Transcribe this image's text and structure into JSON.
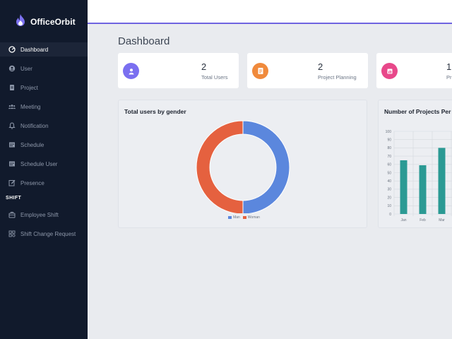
{
  "app": {
    "name": "OfficeOrbit",
    "brand_color": "#6f63e0"
  },
  "sidebar": {
    "items": [
      {
        "label": "Dashboard",
        "icon": "dashboard-icon",
        "active": true
      },
      {
        "label": "User",
        "icon": "user-icon",
        "active": false
      },
      {
        "label": "Project",
        "icon": "clipboard-icon",
        "active": false
      },
      {
        "label": "Meeting",
        "icon": "users-icon",
        "active": false
      },
      {
        "label": "Notification",
        "icon": "bell-icon",
        "active": false
      },
      {
        "label": "Schedule",
        "icon": "calendar-icon",
        "active": false
      },
      {
        "label": "Schedule User",
        "icon": "calendar-user-icon",
        "active": false
      },
      {
        "label": "Presence",
        "icon": "edit-icon",
        "active": false
      }
    ],
    "section_label": "SHIFT",
    "shift_items": [
      {
        "label": "Employee Shift",
        "icon": "briefcase-icon"
      },
      {
        "label": "Shift Change Request",
        "icon": "grid-icon"
      }
    ]
  },
  "main": {
    "title": "Dashboard",
    "stats": [
      {
        "value": "2",
        "label": "Total Users",
        "icon": "user-icon",
        "color": "#7a6ff0"
      },
      {
        "value": "2",
        "label": "Project Planning",
        "icon": "clipboard-icon",
        "color": "#f08a3c"
      },
      {
        "value": "1",
        "label": "Pr",
        "icon": "report-icon",
        "color": "#e8488a"
      }
    ],
    "gender_panel": {
      "title": "Total users by gender"
    },
    "projects_panel": {
      "title": "Number of Projects Per Y"
    }
  },
  "chart_data": [
    {
      "type": "pie",
      "title": "Total users by gender",
      "labels": [
        "Man",
        "Woman"
      ],
      "values": [
        1,
        1
      ],
      "colors": [
        "#5b87dd",
        "#e5613f"
      ],
      "legend": "bottom"
    },
    {
      "type": "bar",
      "title": "Number of Projects Per Y",
      "categories": [
        "Jan",
        "Feb",
        "Mar"
      ],
      "values": [
        65,
        59,
        80
      ],
      "ylim": [
        0,
        100
      ],
      "yticks": [
        0,
        10,
        20,
        30,
        40,
        50,
        60,
        70,
        80,
        90,
        100
      ],
      "grid": true,
      "color": "#2b9a94"
    }
  ]
}
